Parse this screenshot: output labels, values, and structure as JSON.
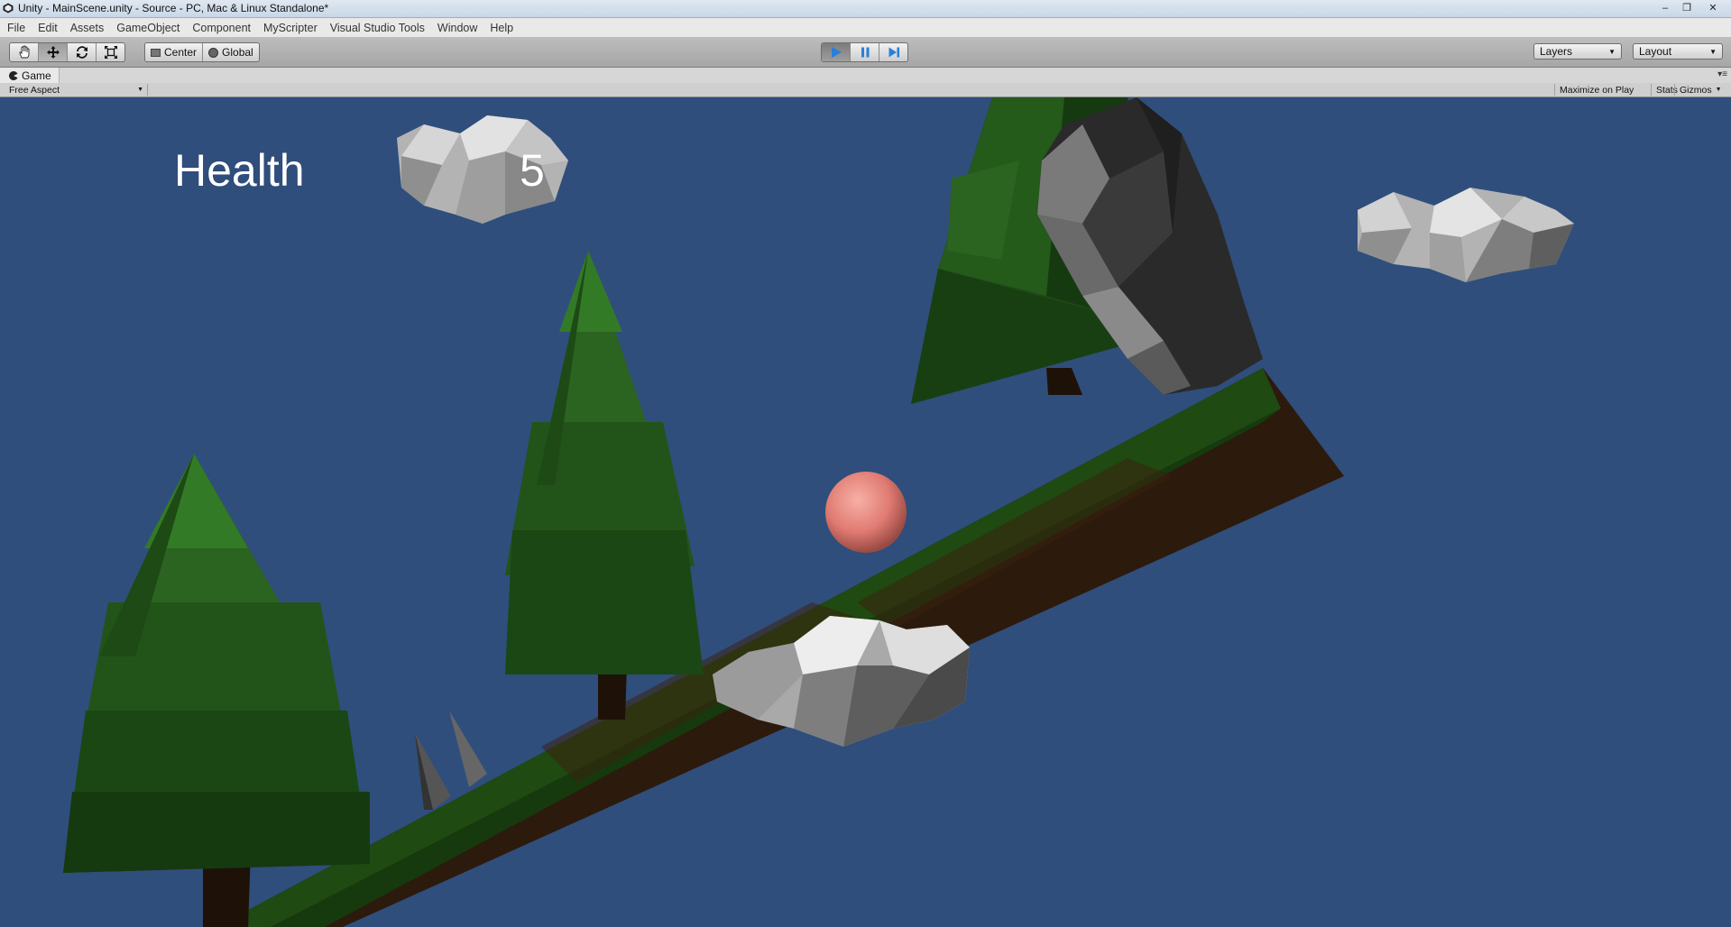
{
  "window": {
    "title": "Unity - MainScene.unity - Source - PC, Mac & Linux Standalone*",
    "buttons": [
      "–",
      "❐",
      "✕"
    ]
  },
  "menu": [
    "File",
    "Edit",
    "Assets",
    "GameObject",
    "Component",
    "MyScripter",
    "Visual Studio Tools",
    "Window",
    "Help"
  ],
  "toolbar": {
    "tools": [
      {
        "name": "hand-tool",
        "icon": "hand-icon",
        "active": false
      },
      {
        "name": "move-tool",
        "icon": "move-icon",
        "active": true
      },
      {
        "name": "rotate-tool",
        "icon": "rotate-icon",
        "active": false
      },
      {
        "name": "scale-tool",
        "icon": "scale-icon",
        "active": false
      }
    ],
    "pivot_label": "Center",
    "space_label": "Global",
    "play": {
      "playing": true,
      "paused": false
    },
    "layers_label": "Layers",
    "layout_label": "Layout",
    "accent_color": "#2a7fd8"
  },
  "game_tab": {
    "title": "Game",
    "aspect": "Free Aspect",
    "maximize_on_play": "Maximize on Play",
    "stats": "Stats",
    "gizmos": "Gizmos"
  },
  "game": {
    "health_label": "Health",
    "health_value": "5",
    "sky_color": "#2f4e7c",
    "ball_color": "#e07b72",
    "grass_color": "#1f4a12",
    "soil_color": "#2c1a0d"
  }
}
